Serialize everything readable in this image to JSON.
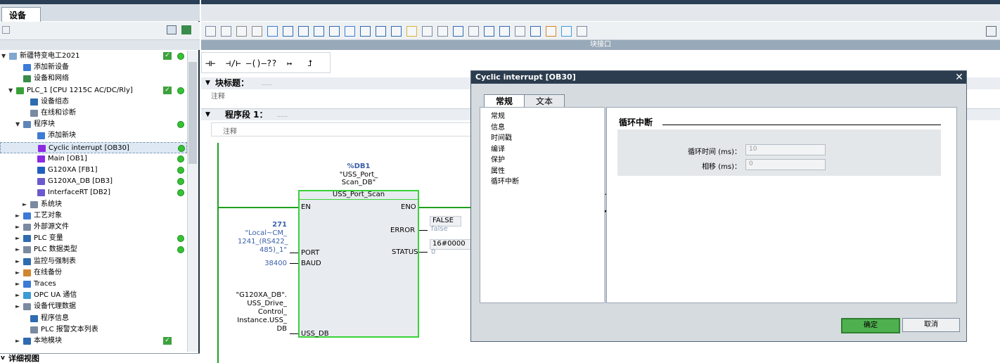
{
  "left_panel": {
    "tab_label": "设备",
    "details_label": "详细视图",
    "tree": [
      {
        "label": "新疆特变电工2021",
        "indent": 0,
        "arrow": "▼",
        "color": "#7fa7d0",
        "check": true,
        "dot": true
      },
      {
        "label": "添加新设备",
        "indent": 2,
        "arrow": "",
        "color": "#3c7bd6",
        "check": false,
        "dot": false
      },
      {
        "label": "设备和网络",
        "indent": 2,
        "arrow": "",
        "color": "#3a8c4a",
        "check": false,
        "dot": false
      },
      {
        "label": "PLC_1 [CPU 1215C AC/DC/Rly]",
        "indent": 1,
        "arrow": "▼",
        "color": "#39a039",
        "check": true,
        "dot": true
      },
      {
        "label": "设备组态",
        "indent": 3,
        "arrow": "",
        "color": "#2f6bb0",
        "check": false,
        "dot": false
      },
      {
        "label": "在线和诊断",
        "indent": 3,
        "arrow": "",
        "color": "#7a8aa0",
        "check": false,
        "dot": false
      },
      {
        "label": "程序块",
        "indent": 2,
        "arrow": "▼",
        "color": "#5f86b8",
        "check": false,
        "dot": true
      },
      {
        "label": "添加新块",
        "indent": 4,
        "arrow": "",
        "color": "#3c7bd6",
        "check": false,
        "dot": false
      },
      {
        "label": "Cyclic interrupt [OB30]",
        "indent": 4,
        "arrow": "",
        "color": "#8a2be2",
        "check": false,
        "dot": true,
        "selected": true
      },
      {
        "label": "Main [OB1]",
        "indent": 4,
        "arrow": "",
        "color": "#8a2be2",
        "check": false,
        "dot": true
      },
      {
        "label": "G120XA [FB1]",
        "indent": 4,
        "arrow": "",
        "color": "#1f5fbf",
        "check": false,
        "dot": true
      },
      {
        "label": "G120XA_DB [DB3]",
        "indent": 4,
        "arrow": "",
        "color": "#6a5acd",
        "check": false,
        "dot": true
      },
      {
        "label": "InterfaceRT [DB2]",
        "indent": 4,
        "arrow": "",
        "color": "#6a5acd",
        "check": false,
        "dot": true
      },
      {
        "label": "系统块",
        "indent": 3,
        "arrow": "►",
        "color": "#7a8aa0",
        "check": false,
        "dot": false
      },
      {
        "label": "工艺对象",
        "indent": 2,
        "arrow": "►",
        "color": "#3c7bd6",
        "check": false,
        "dot": false
      },
      {
        "label": "外部源文件",
        "indent": 2,
        "arrow": "►",
        "color": "#7a8aa0",
        "check": false,
        "dot": false
      },
      {
        "label": "PLC 变量",
        "indent": 2,
        "arrow": "►",
        "color": "#2f6bb0",
        "check": false,
        "dot": true
      },
      {
        "label": "PLC 数据类型",
        "indent": 2,
        "arrow": "►",
        "color": "#7a8aa0",
        "check": false,
        "dot": true
      },
      {
        "label": "监控与强制表",
        "indent": 2,
        "arrow": "►",
        "color": "#2f6bb0",
        "check": false,
        "dot": false
      },
      {
        "label": "在线备份",
        "indent": 2,
        "arrow": "►",
        "color": "#d0862f",
        "check": false,
        "dot": false
      },
      {
        "label": "Traces",
        "indent": 2,
        "arrow": "►",
        "color": "#3c7bd6",
        "check": false,
        "dot": false
      },
      {
        "label": "OPC UA 通信",
        "indent": 2,
        "arrow": "►",
        "color": "#3c9bd6",
        "check": false,
        "dot": false
      },
      {
        "label": "设备代理数据",
        "indent": 2,
        "arrow": "►",
        "color": "#7a8aa0",
        "check": false,
        "dot": false
      },
      {
        "label": "程序信息",
        "indent": 3,
        "arrow": "",
        "color": "#2f6bb0",
        "check": false,
        "dot": false
      },
      {
        "label": "PLC 报警文本列表",
        "indent": 3,
        "arrow": "",
        "color": "#7a8aa0",
        "check": false,
        "dot": false
      },
      {
        "label": "本地模块",
        "indent": 2,
        "arrow": "►",
        "color": "#2f6bb0",
        "check": true,
        "dot": false
      }
    ]
  },
  "main": {
    "interface_strip": "块接口",
    "block_title_label": "块标题：",
    "block_title_value": "......",
    "block_comment": "注释",
    "network_label": "程序段 1：",
    "network_title_value": "......",
    "network_comment": "注释",
    "lad_symbols": [
      "⊣⊢",
      "⊣/⊢",
      "–()–",
      "??",
      "↦",
      "⮥"
    ],
    "fb": {
      "db_name": "%DB1",
      "db_symbol_1": "\"USS_Port_",
      "db_symbol_2": "Scan_DB\"",
      "name": "USS_Port_Scan",
      "pin_en": "EN",
      "pin_eno": "ENO",
      "pin_port": "PORT",
      "pin_baud": "BAUD",
      "pin_uss_db": "USS_DB",
      "pin_error": "ERROR",
      "pin_status": "STATUS",
      "port_value": "271",
      "port_symbol": "\"Local~CM_ 1241_(RS422_ 485)_1\"",
      "baud_value": "38400",
      "ussdb_symbol": "\"G120XA_DB\". USS_Drive_ Control_ Instance.USS_ DB",
      "error_box": "FALSE",
      "error_value": "false",
      "status_box": "16#0000",
      "status_value": "0"
    }
  },
  "dialog": {
    "title": "Cyclic interrupt [OB30]",
    "close": "✕",
    "tabs": [
      "常规",
      "文本"
    ],
    "nav_items": [
      "常规",
      "信息",
      "时间戳",
      "编译",
      "保护",
      "属性",
      "循环中断"
    ],
    "section_title": "循环中断",
    "cycle_time_label": "循环时间 (ms)：",
    "cycle_time_value": "10",
    "phase_label": "相移 (ms)：",
    "phase_value": "0",
    "ok_label": "确定",
    "cancel_label": "取消"
  },
  "colors": {
    "accent_green": "#38d238",
    "title_dark": "#2c3d4f",
    "status_green": "#35c235"
  }
}
